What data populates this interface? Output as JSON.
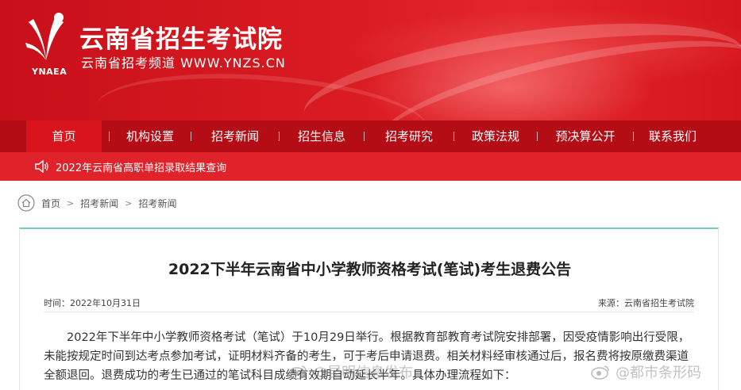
{
  "header": {
    "logo_text": "YNAEA",
    "site_title": "云南省招生考试院",
    "site_subtitle": "云南省招考频道 WWW.YNZS.CN"
  },
  "nav": {
    "items": [
      {
        "label": "首页"
      },
      {
        "label": "机构设置"
      },
      {
        "label": "招考新闻"
      },
      {
        "label": "招生信息"
      },
      {
        "label": "招考研究"
      },
      {
        "label": "政策法规"
      },
      {
        "label": "预决算公开"
      },
      {
        "label": "联系我们"
      }
    ]
  },
  "notice": {
    "text": "2022年云南省高职单招录取结果查询"
  },
  "breadcrumb": [
    "首页",
    "招考新闻",
    "招考新闻"
  ],
  "article": {
    "title": "2022下半年云南省中小学教师资格考试(笔试)考生退费公告",
    "time": "时间：2022年10月31日",
    "source": "来源：云南省招生考试院",
    "body": "2022年下半年中小学教师资格考试（笔试）于10月29日举行。根据教育部教育考试院安排部署，因受疫情影响出行受限，未能按规定时间到达考点参加考试，证明材料齐备的考生，可于考后申请退费。相关材料经审核通过后，报名费将按原缴费渠道全额退回。退费成功的考生已通过的笔试科目成绩有效期自动延长半年。具体办理流程如下："
  },
  "watermarks": [
    "@昆明信息发布",
    "@都市条形码"
  ],
  "colors": {
    "banner_red": "#d91b22",
    "nav_red": "#b50d15",
    "nav_active": "#d8141d",
    "notice_red": "#e0232b",
    "card_top_border": "#79c4c9"
  }
}
